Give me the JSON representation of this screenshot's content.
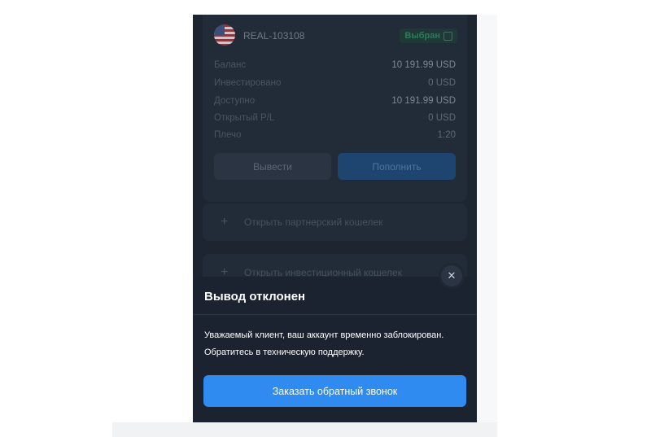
{
  "account": {
    "id": "REAL-103108",
    "selected_label": "Выбран",
    "rows": [
      {
        "label": "Баланс",
        "value": "10 191.99 USD"
      },
      {
        "label": "Инвестировано",
        "value": "0 USD"
      },
      {
        "label": "Доступно",
        "value": "10 191.99 USD"
      },
      {
        "label": "Открытый P/L",
        "value": "0 USD"
      },
      {
        "label": "Плечо",
        "value": "1:20"
      }
    ],
    "withdraw_label": "Вывести",
    "deposit_label": "Пополнить"
  },
  "wallets": {
    "partner_label": "Открыть партнерский кошелек",
    "invest_label": "Открыть инвестиционный кошелек"
  },
  "modal": {
    "close_symbol": "✕",
    "title": "Вывод отклонен",
    "message_line1": "Уважаемый клиент, ваш аккаунт временно заблокирован.",
    "message_line2": "Обратитесь в техническую поддержку.",
    "button_label": "Заказать обратный звонок"
  },
  "colors": {
    "background": "#1d2531",
    "accent": "#2f8bf0",
    "sheet": "#1b2330"
  }
}
